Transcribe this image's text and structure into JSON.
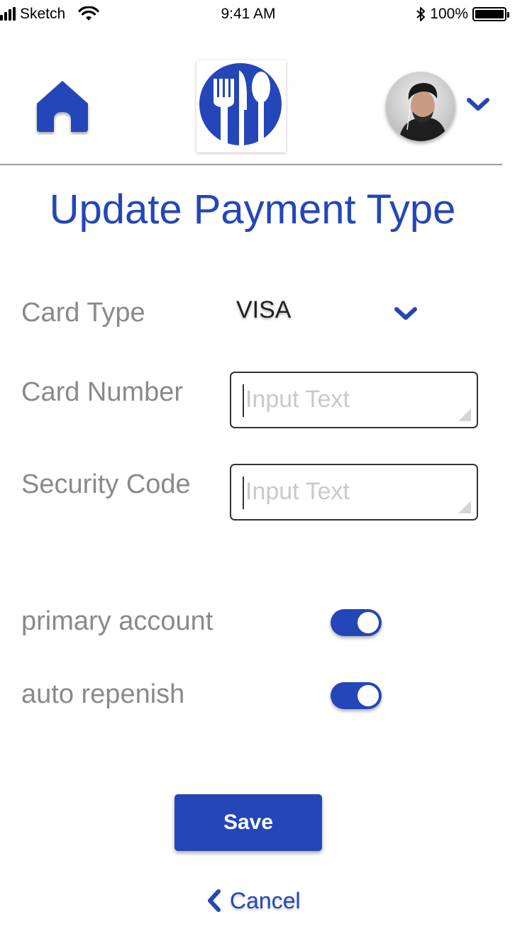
{
  "status_bar": {
    "carrier": "Sketch",
    "time": "9:41 AM",
    "battery": "100%"
  },
  "header": {
    "home_icon": "home-icon",
    "logo_icon": "fork-knife-spoon-icon",
    "avatar_icon": "user-avatar",
    "chevron_icon": "chevron-down-icon"
  },
  "page": {
    "title": "Update Payment Type"
  },
  "form": {
    "card_type": {
      "label": "Card Type",
      "value": "VISA"
    },
    "card_number": {
      "label": "Card Number",
      "placeholder": "Input Text"
    },
    "security_code": {
      "label": "Security Code",
      "placeholder": "Input Text"
    },
    "primary_account": {
      "label": "primary account",
      "on": true
    },
    "auto_replenish": {
      "label": "auto repenish",
      "on": true
    }
  },
  "actions": {
    "save_label": "Save",
    "cancel_label": "Cancel"
  },
  "colors": {
    "accent": "#2446b9",
    "label": "#8a8a8a",
    "placeholder": "#c9c9c9"
  }
}
